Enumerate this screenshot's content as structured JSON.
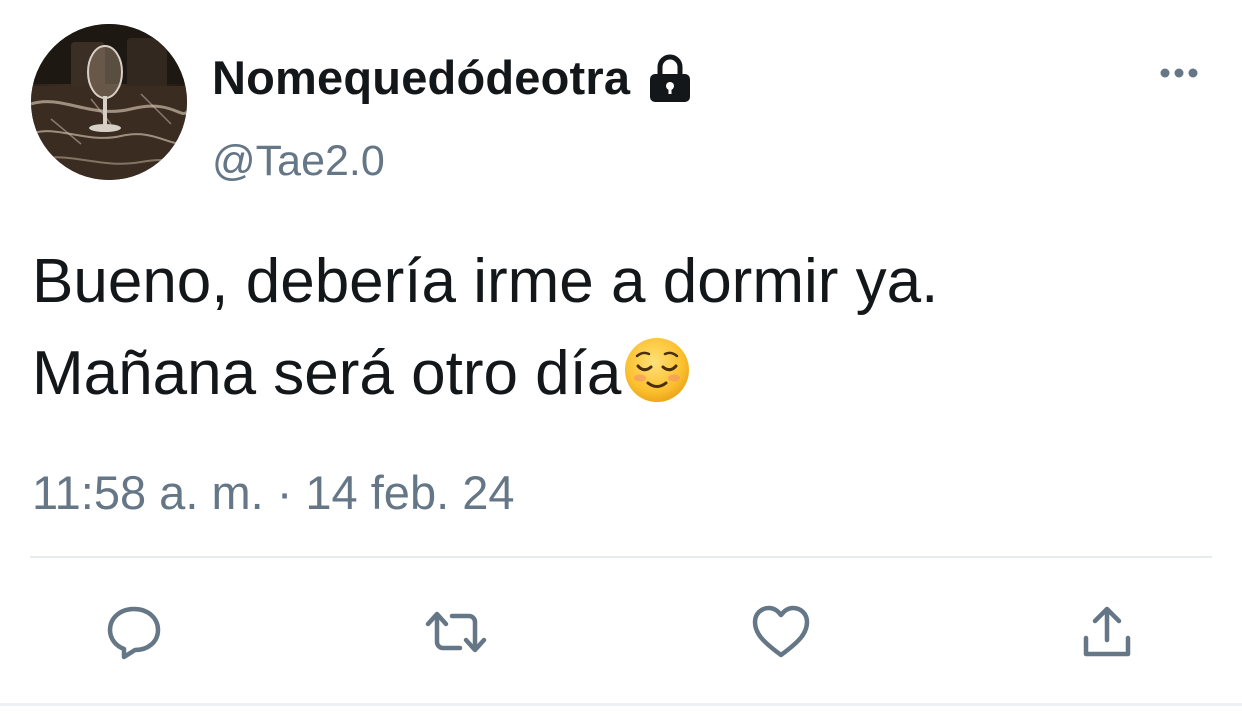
{
  "tweet": {
    "display_name": "Nomequedódeotra",
    "protected_account": true,
    "handle": "@Tae2.0",
    "text_line_1": "Bueno, debería irme a dormir ya.",
    "text_line_2": "Mañana será otro día",
    "text_emoji": "relieved-face",
    "timestamp": "11:58 a. m. · 14 feb. 24"
  },
  "icons": {
    "lock": "lock-icon",
    "more": "more-icon",
    "reply": "reply-icon",
    "retweet": "retweet-icon",
    "like": "heart-icon",
    "share": "share-icon"
  },
  "colors": {
    "text_primary": "#14171a",
    "text_secondary": "#657786",
    "icon_gray": "#657786",
    "divider": "#e6ecf0"
  }
}
